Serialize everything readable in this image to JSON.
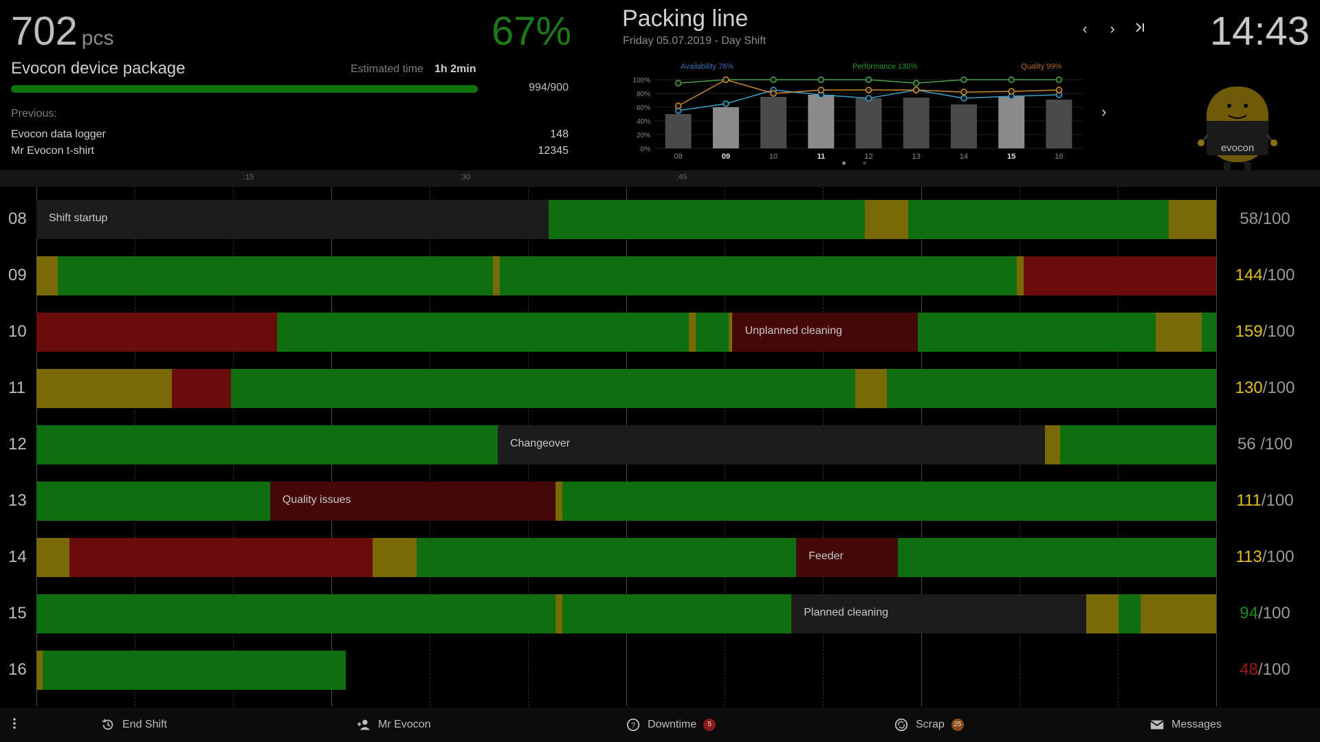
{
  "header": {
    "pcs_value": "702",
    "pcs_unit": "pcs",
    "oee": "67%",
    "product": "Evocon device package",
    "estimated_label": "Estimated time",
    "estimated_value": "1h 2min",
    "progress_text": "994/900",
    "progress_fraction": 1.0,
    "previous_label": "Previous:",
    "previous": [
      {
        "name": "Evocon data logger",
        "value": "148"
      },
      {
        "name": "Mr Evocon t-shirt",
        "value": "12345"
      }
    ],
    "line_title": "Packing line",
    "line_subtitle": "Friday 05.07.2019 - Day Shift",
    "clock": "14:43",
    "nav_icons": [
      "chevron-left-icon",
      "chevron-right-icon",
      "skip-to-end-icon"
    ]
  },
  "chart_data": {
    "type": "bar",
    "categories": [
      "08",
      "09",
      "10",
      "11",
      "12",
      "13",
      "14",
      "15",
      "16"
    ],
    "bold_categories": [
      "09",
      "11",
      "15"
    ],
    "values": [
      50,
      60,
      75,
      78,
      73,
      74,
      64,
      76,
      71
    ],
    "ylim": [
      0,
      100
    ],
    "yticks": [
      "0%",
      "20%",
      "40%",
      "60%",
      "80%",
      "100%"
    ],
    "legend": [
      {
        "name": "Availability 76%",
        "color": "#3a6fb0"
      },
      {
        "name": "Performance 130%",
        "color": "#1d9a1d"
      },
      {
        "name": "Quality 99%",
        "color": "#b06a1a"
      }
    ],
    "series": [
      {
        "name": "Availability",
        "color": "#3aa0c8",
        "values": [
          55,
          65,
          85,
          78,
          73,
          85,
          73,
          76,
          78
        ]
      },
      {
        "name": "Performance",
        "color": "#4aa04a",
        "values": [
          95,
          130,
          110,
          120,
          100,
          95,
          130,
          115,
          120
        ]
      },
      {
        "name": "Quality",
        "color": "#d08a30",
        "values": [
          62,
          100,
          80,
          85,
          85,
          85,
          82,
          83,
          85
        ]
      }
    ]
  },
  "ruler": [
    ":15",
    ":30",
    ":45"
  ],
  "rows": [
    {
      "hour": "08",
      "count": "58",
      "den": "/100",
      "count_color": "#9a9a9a",
      "segments": [
        {
          "s": 0,
          "e": 0.434,
          "c": "grey",
          "label": "Shift startup"
        },
        {
          "s": 0.434,
          "e": 0.702,
          "c": "green"
        },
        {
          "s": 0.702,
          "e": 0.739,
          "c": "yellow"
        },
        {
          "s": 0.739,
          "e": 0.96,
          "c": "green"
        },
        {
          "s": 0.96,
          "e": 1.0,
          "c": "yellow"
        }
      ]
    },
    {
      "hour": "09",
      "count": "144",
      "den": "/100",
      "count_color": "#e0c020",
      "segments": [
        {
          "s": 0,
          "e": 0.018,
          "c": "yellow"
        },
        {
          "s": 0.018,
          "e": 0.387,
          "c": "green"
        },
        {
          "s": 0.387,
          "e": 0.393,
          "c": "yellow"
        },
        {
          "s": 0.393,
          "e": 0.831,
          "c": "green"
        },
        {
          "s": 0.831,
          "e": 0.837,
          "c": "yellow"
        },
        {
          "s": 0.837,
          "e": 1.0,
          "c": "red"
        }
      ]
    },
    {
      "hour": "10",
      "count": "159",
      "den": "/100",
      "count_color": "#e0c020",
      "segments": [
        {
          "s": 0,
          "e": 0.204,
          "c": "red"
        },
        {
          "s": 0.204,
          "e": 0.553,
          "c": "green"
        },
        {
          "s": 0.553,
          "e": 0.559,
          "c": "yellow"
        },
        {
          "s": 0.559,
          "e": 0.587,
          "c": "green"
        },
        {
          "s": 0.587,
          "e": 0.59,
          "c": "yellow"
        },
        {
          "s": 0.59,
          "e": 0.747,
          "c": "darkred",
          "label": "Unplanned cleaning"
        },
        {
          "s": 0.747,
          "e": 0.949,
          "c": "green"
        },
        {
          "s": 0.949,
          "e": 0.988,
          "c": "yellow"
        },
        {
          "s": 0.988,
          "e": 1.0,
          "c": "green"
        }
      ]
    },
    {
      "hour": "11",
      "count": "130",
      "den": "/100",
      "count_color": "#e0c020",
      "segments": [
        {
          "s": 0,
          "e": 0.115,
          "c": "yellow"
        },
        {
          "s": 0.115,
          "e": 0.165,
          "c": "red"
        },
        {
          "s": 0.165,
          "e": 0.694,
          "c": "green"
        },
        {
          "s": 0.694,
          "e": 0.721,
          "c": "yellow"
        },
        {
          "s": 0.721,
          "e": 1.0,
          "c": "green"
        }
      ]
    },
    {
      "hour": "12",
      "count": "56",
      "den": " /100",
      "count_color": "#9a9a9a",
      "segments": [
        {
          "s": 0,
          "e": 0.391,
          "c": "green"
        },
        {
          "s": 0.391,
          "e": 0.855,
          "c": "grey",
          "label": "Changeover"
        },
        {
          "s": 0.855,
          "e": 0.868,
          "c": "yellow"
        },
        {
          "s": 0.868,
          "e": 1.0,
          "c": "green"
        }
      ]
    },
    {
      "hour": "13",
      "count": "111",
      "den": "/100",
      "count_color": "#e0c020",
      "segments": [
        {
          "s": 0,
          "e": 0.198,
          "c": "green"
        },
        {
          "s": 0.198,
          "e": 0.44,
          "c": "darkred",
          "label": "Quality issues"
        },
        {
          "s": 0.44,
          "e": 0.446,
          "c": "yellow"
        },
        {
          "s": 0.446,
          "e": 1.0,
          "c": "green"
        }
      ]
    },
    {
      "hour": "14",
      "count": "113",
      "den": "/100",
      "count_color": "#e0c020",
      "segments": [
        {
          "s": 0,
          "e": 0.028,
          "c": "yellow"
        },
        {
          "s": 0.028,
          "e": 0.285,
          "c": "red"
        },
        {
          "s": 0.285,
          "e": 0.322,
          "c": "yellow"
        },
        {
          "s": 0.322,
          "e": 0.644,
          "c": "green"
        },
        {
          "s": 0.644,
          "e": 0.73,
          "c": "darkred",
          "label": "Feeder"
        },
        {
          "s": 0.73,
          "e": 1.0,
          "c": "green"
        }
      ]
    },
    {
      "hour": "15",
      "count": "94",
      "den": "/100",
      "count_color": "#1d8a1d",
      "segments": [
        {
          "s": 0,
          "e": 0.44,
          "c": "green"
        },
        {
          "s": 0.44,
          "e": 0.446,
          "c": "yellow"
        },
        {
          "s": 0.446,
          "e": 0.64,
          "c": "green"
        },
        {
          "s": 0.64,
          "e": 0.89,
          "c": "grey",
          "label": "Planned cleaning"
        },
        {
          "s": 0.89,
          "e": 0.917,
          "c": "yellow"
        },
        {
          "s": 0.917,
          "e": 0.936,
          "c": "green"
        },
        {
          "s": 0.936,
          "e": 1.0,
          "c": "yellow"
        }
      ]
    },
    {
      "hour": "16",
      "count": "48",
      "den": "/100",
      "count_color": "#a01818",
      "segments": [
        {
          "s": 0,
          "e": 0.005,
          "c": "yellow"
        },
        {
          "s": 0.005,
          "e": 0.262,
          "c": "green"
        }
      ]
    }
  ],
  "bottom_bar": {
    "menu_icon": "more-vertical-icon",
    "items": [
      {
        "label": "End Shift",
        "icon": "history-icon"
      },
      {
        "label": "Mr Evocon",
        "icon": "add-user-icon"
      },
      {
        "label": "Downtime",
        "icon": "help-circle-icon",
        "badge": "5"
      },
      {
        "label": "Scrap",
        "icon": "recycle-icon",
        "badge": "25"
      },
      {
        "label": "Messages",
        "icon": "mail-icon"
      }
    ]
  },
  "mascot": {
    "brand_text": "evocon"
  }
}
